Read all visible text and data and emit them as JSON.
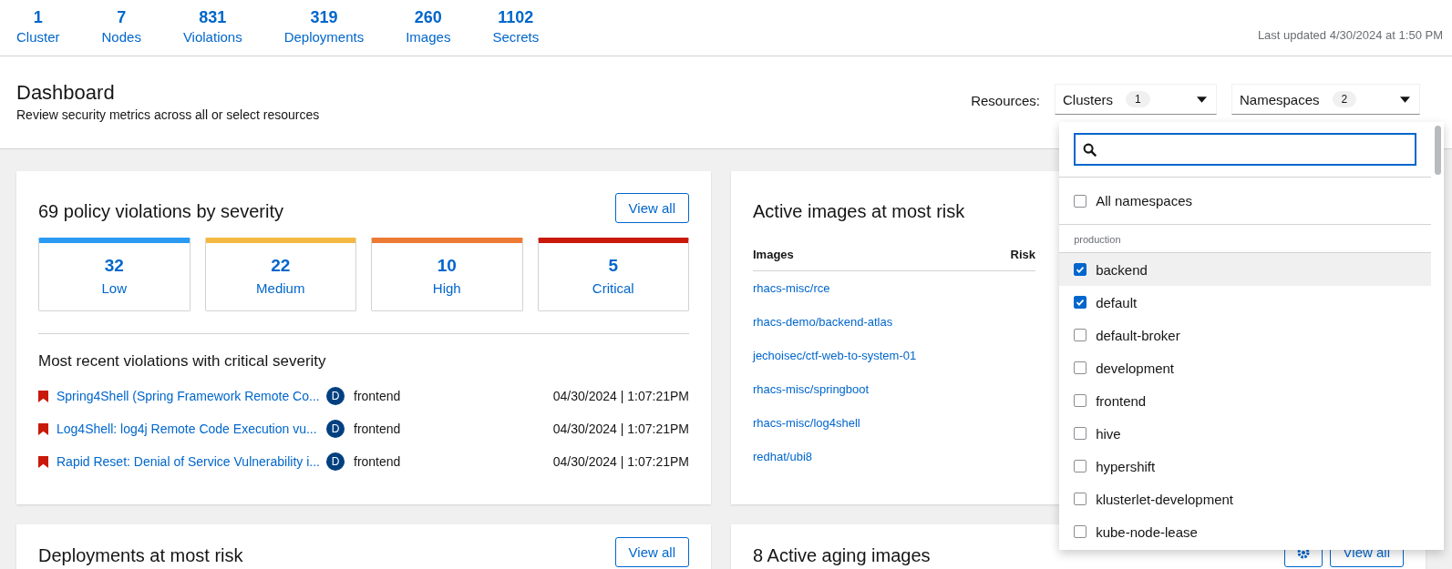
{
  "stats": [
    {
      "count": "1",
      "label": "Cluster"
    },
    {
      "count": "7",
      "label": "Nodes"
    },
    {
      "count": "831",
      "label": "Violations"
    },
    {
      "count": "319",
      "label": "Deployments"
    },
    {
      "count": "260",
      "label": "Images"
    },
    {
      "count": "1102",
      "label": "Secrets"
    }
  ],
  "last_updated": "Last updated 4/30/2024 at 1:50 PM",
  "header": {
    "title": "Dashboard",
    "subtitle": "Review security metrics across all or select resources",
    "resources_label": "Resources:",
    "filters": [
      {
        "label": "Clusters",
        "count": "1"
      },
      {
        "label": "Namespaces",
        "count": "2"
      }
    ]
  },
  "namespace_menu": {
    "all": {
      "label": "All namespaces",
      "checked": false
    },
    "group": "production",
    "items": [
      {
        "label": "backend",
        "checked": true,
        "highlighted": true
      },
      {
        "label": "default",
        "checked": true,
        "highlighted": false
      },
      {
        "label": "default-broker",
        "checked": false,
        "highlighted": false
      },
      {
        "label": "development",
        "checked": false,
        "highlighted": false
      },
      {
        "label": "frontend",
        "checked": false,
        "highlighted": false
      },
      {
        "label": "hive",
        "checked": false,
        "highlighted": false
      },
      {
        "label": "hypershift",
        "checked": false,
        "highlighted": false
      },
      {
        "label": "klusterlet-development",
        "checked": false,
        "highlighted": false
      },
      {
        "label": "kube-node-lease",
        "checked": false,
        "highlighted": false
      }
    ]
  },
  "violations_card": {
    "title": "69 policy violations by severity",
    "button": "View all",
    "severities": [
      {
        "count": "32",
        "label": "Low",
        "color": "#2b9af3"
      },
      {
        "count": "22",
        "label": "Medium",
        "color": "#f4b942"
      },
      {
        "count": "10",
        "label": "High",
        "color": "#ec7a35"
      },
      {
        "count": "5",
        "label": "Critical",
        "color": "#c9190b"
      }
    ],
    "recent_title": "Most recent violations with critical severity",
    "recent": [
      {
        "policy": "Spring4Shell (Spring Framework Remote Co...",
        "badge": "D",
        "deployment": "frontend",
        "time": "04/30/2024 | 1:07:21PM"
      },
      {
        "policy": "Log4Shell: log4j Remote Code Execution vu...",
        "badge": "D",
        "deployment": "frontend",
        "time": "04/30/2024 | 1:07:21PM"
      },
      {
        "policy": "Rapid Reset: Denial of Service Vulnerability i...",
        "badge": "D",
        "deployment": "frontend",
        "time": "04/30/2024 | 1:07:21PM"
      }
    ]
  },
  "images_card": {
    "title": "Active images at most risk",
    "columns": [
      "Images",
      "Risk"
    ],
    "rows": [
      "rhacs-misc/rce",
      "rhacs-demo/backend-atlas",
      "jechoisec/ctf-web-to-system-01",
      "rhacs-misc/springboot",
      "rhacs-misc/log4shell",
      "redhat/ubi8"
    ]
  },
  "deployments_card": {
    "title": "Deployments at most risk",
    "button": "View all"
  },
  "aging_card": {
    "title": "8 Active aging images",
    "button": "View all"
  }
}
